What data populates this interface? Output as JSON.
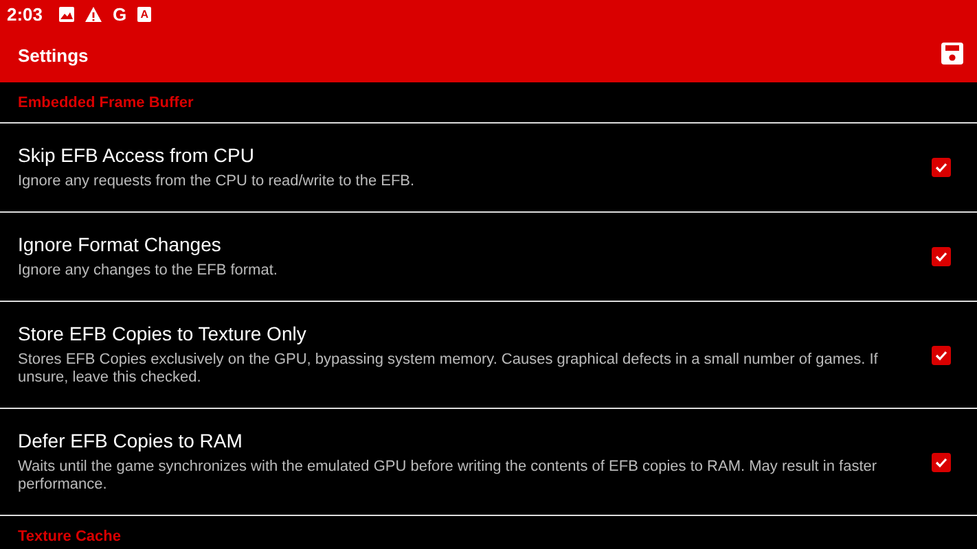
{
  "status_bar": {
    "time": "2:03",
    "icons": [
      {
        "kind": "picture"
      },
      {
        "kind": "warning"
      },
      {
        "kind": "letter",
        "text": "G"
      },
      {
        "kind": "boxed",
        "text": "A"
      }
    ]
  },
  "app_bar": {
    "title": "Settings"
  },
  "list": [
    {
      "kind": "header",
      "title": "Embedded Frame Buffer"
    },
    {
      "kind": "checkbox",
      "title": "Skip EFB Access from CPU",
      "description": "Ignore any requests from the CPU to read/write to the EFB.",
      "checked": true
    },
    {
      "kind": "checkbox",
      "title": "Ignore Format Changes",
      "description": "Ignore any changes to the EFB format.",
      "checked": true
    },
    {
      "kind": "checkbox",
      "title": "Store EFB Copies to Texture Only",
      "description": "Stores EFB Copies exclusively on the GPU, bypassing system memory. Causes graphical defects in a small number of games. If unsure, leave this checked.",
      "checked": true
    },
    {
      "kind": "checkbox",
      "title": "Defer EFB Copies to RAM",
      "description": "Waits until the game synchronizes with the emulated GPU before writing the contents of EFB copies to RAM. May result in faster performance.",
      "checked": true
    },
    {
      "kind": "header",
      "title": "Texture Cache"
    }
  ]
}
